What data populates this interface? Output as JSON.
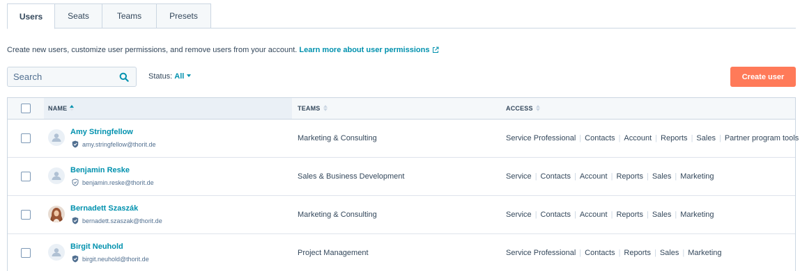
{
  "tabs": [
    {
      "label": "Users",
      "active": true
    },
    {
      "label": "Seats",
      "active": false
    },
    {
      "label": "Teams",
      "active": false
    },
    {
      "label": "Presets",
      "active": false
    }
  ],
  "description": {
    "text": "Create new users, customize user permissions, and remove users from your account.",
    "link_label": "Learn more about user permissions",
    "link_icon": "external-link-icon"
  },
  "search": {
    "placeholder": "Search",
    "icon": "search-icon"
  },
  "status_filter": {
    "label": "Status:",
    "value": "All"
  },
  "create_button": {
    "label": "Create user"
  },
  "table": {
    "columns": [
      {
        "label": "NAME",
        "sort": "ascending"
      },
      {
        "label": "TEAMS",
        "sort": "none"
      },
      {
        "label": "ACCESS",
        "sort": "none"
      }
    ],
    "rows": [
      {
        "name": "Amy Stringfellow",
        "email": "amy.stringfellow@thorit.de",
        "avatar": "default-avatar",
        "verified": true,
        "team": "Marketing & Consulting",
        "access": [
          "Service Professional",
          "Contacts",
          "Account",
          "Reports",
          "Sales",
          "Partner program tools"
        ]
      },
      {
        "name": "Benjamin Reske",
        "email": "benjamin.reske@thorit.de",
        "avatar": "default-avatar",
        "verified": false,
        "team": "Sales & Business Development",
        "access": [
          "Service",
          "Contacts",
          "Account",
          "Reports",
          "Sales",
          "Marketing"
        ]
      },
      {
        "name": "Bernadett Szaszák",
        "email": "bernadett.szaszak@thorit.de",
        "avatar": "photo-avatar",
        "verified": true,
        "team": "Marketing & Consulting",
        "access": [
          "Service",
          "Contacts",
          "Account",
          "Reports",
          "Sales",
          "Marketing"
        ]
      },
      {
        "name": "Birgit Neuhold",
        "email": "birgit.neuhold@thorit.de",
        "avatar": "default-avatar",
        "verified": true,
        "team": "Project Management",
        "access": [
          "Service Professional",
          "Contacts",
          "Reports",
          "Sales",
          "Marketing"
        ]
      }
    ]
  },
  "colors": {
    "accent": "#0091ae",
    "primary_button": "#ff7a59",
    "text": "#33475b",
    "border": "#cbd6e2"
  }
}
